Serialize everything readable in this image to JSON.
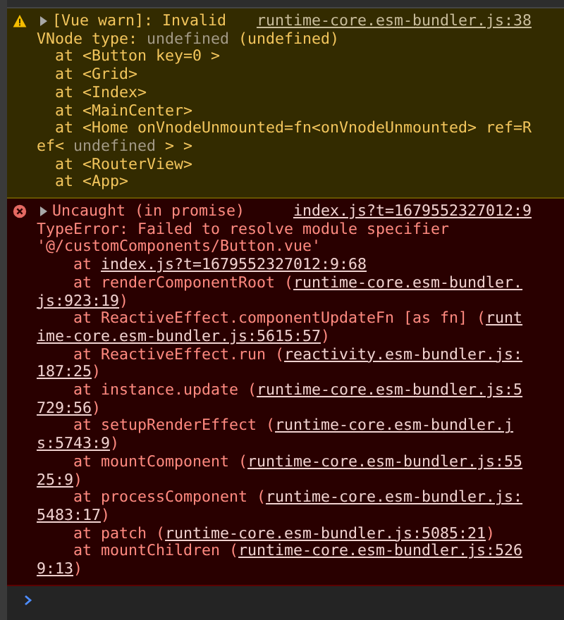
{
  "messages": [
    {
      "kind": "warning",
      "expanded": false,
      "source": "runtime-core.esm-bundler.js:38",
      "summary": "[Vue warn]: Invalid",
      "lines": [
        [
          {
            "text": "VNode type: ",
            "kind": "text"
          },
          {
            "text": "undefined",
            "kind": "value"
          },
          {
            "text": " (undefined)",
            "kind": "text"
          }
        ]
      ],
      "frames": [
        [
          {
            "text": "at <Button key=0 >",
            "kind": "text"
          }
        ],
        [
          {
            "text": "at <Grid>",
            "kind": "text"
          }
        ],
        [
          {
            "text": "at <Index>",
            "kind": "text"
          }
        ],
        [
          {
            "text": "at <MainCenter>",
            "kind": "text"
          }
        ],
        [
          {
            "text": "at <Home onVnodeUnmounted=fn<onVnodeUnmounted> ref=Ref< ",
            "kind": "text"
          },
          {
            "text": "undefined",
            "kind": "value"
          },
          {
            "text": " > >",
            "kind": "text"
          }
        ],
        [
          {
            "text": "at <RouterView>",
            "kind": "text"
          }
        ],
        [
          {
            "text": "at <App>",
            "kind": "text"
          }
        ]
      ]
    },
    {
      "kind": "error",
      "expanded": false,
      "source": "index.js?t=1679552327012:9",
      "summary": "Uncaught (in promise)",
      "lines": [
        [
          {
            "text": "TypeError: Failed to resolve module specifier '@/customComponents/Button.vue'",
            "kind": "text"
          }
        ]
      ],
      "frames": [
        [
          {
            "text": "at ",
            "kind": "text"
          },
          {
            "text": "index.js?t=1679552327012:9:68",
            "kind": "link"
          }
        ],
        [
          {
            "text": "at renderComponentRoot (",
            "kind": "text"
          },
          {
            "text": "runtime-core.esm-bundler.js:923:19",
            "kind": "link"
          },
          {
            "text": ")",
            "kind": "text"
          }
        ],
        [
          {
            "text": "at ReactiveEffect.componentUpdateFn [as fn] (",
            "kind": "text"
          },
          {
            "text": "runtime-core.esm-bundler.js:5615:57",
            "kind": "link"
          },
          {
            "text": ")",
            "kind": "text"
          }
        ],
        [
          {
            "text": "at ReactiveEffect.run (",
            "kind": "text"
          },
          {
            "text": "reactivity.esm-bundler.js:187:25",
            "kind": "link"
          },
          {
            "text": ")",
            "kind": "text"
          }
        ],
        [
          {
            "text": "at instance.update (",
            "kind": "text"
          },
          {
            "text": "runtime-core.esm-bundler.js:5729:56",
            "kind": "link"
          },
          {
            "text": ")",
            "kind": "text"
          }
        ],
        [
          {
            "text": "at setupRenderEffect (",
            "kind": "text"
          },
          {
            "text": "runtime-core.esm-bundler.js:5743:9",
            "kind": "link"
          },
          {
            "text": ")",
            "kind": "text"
          }
        ],
        [
          {
            "text": "at mountComponent (",
            "kind": "text"
          },
          {
            "text": "runtime-core.esm-bundler.js:5525:9",
            "kind": "link"
          },
          {
            "text": ")",
            "kind": "text"
          }
        ],
        [
          {
            "text": "at processComponent (",
            "kind": "text"
          },
          {
            "text": "runtime-core.esm-bundler.js:5483:17",
            "kind": "link"
          },
          {
            "text": ")",
            "kind": "text"
          }
        ],
        [
          {
            "text": "at patch (",
            "kind": "text"
          },
          {
            "text": "runtime-core.esm-bundler.js:5085:21",
            "kind": "link"
          },
          {
            "text": ")",
            "kind": "text"
          }
        ],
        [
          {
            "text": "at mountChildren (",
            "kind": "text"
          },
          {
            "text": "runtime-core.esm-bundler.js:5269:13",
            "kind": "link"
          },
          {
            "text": ")",
            "kind": "text"
          }
        ]
      ]
    }
  ]
}
